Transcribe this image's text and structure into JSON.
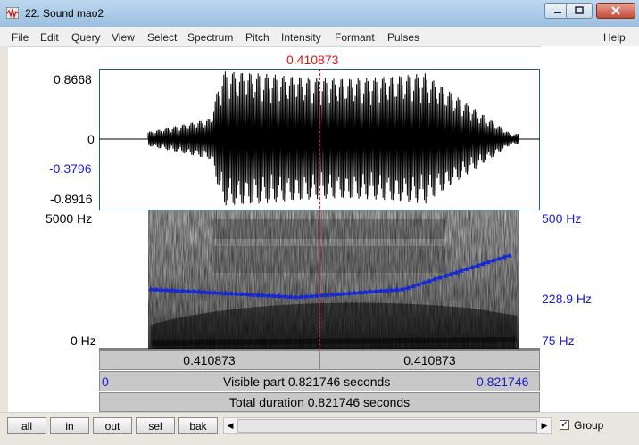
{
  "window": {
    "title": "22. Sound mao2"
  },
  "menu": [
    "File",
    "Edit",
    "Query",
    "View",
    "Select",
    "Spectrum",
    "Pitch",
    "Intensity",
    "Formant",
    "Pulses",
    "Help"
  ],
  "cursor": {
    "time": "0.410873"
  },
  "waveform": {
    "max_label": "0.8668",
    "zero_label": "0",
    "cursor_value": "-0.3796",
    "min_label": "-0.8916"
  },
  "spectrogram": {
    "top_label": "5000 Hz",
    "bottom_label": "0 Hz"
  },
  "pitch": {
    "top_label": "500 Hz",
    "cursor_value": "228.9 Hz",
    "bottom_label": "75 Hz"
  },
  "timebars": {
    "left_segment": "0.410873",
    "right_segment": "0.410873",
    "visible_start": "0",
    "visible_text": "Visible part 0.821746 seconds",
    "visible_end": "0.821746",
    "total_text": "Total duration 0.821746 seconds"
  },
  "buttons": {
    "all": "all",
    "in": "in",
    "out": "out",
    "sel": "sel",
    "bak": "bak"
  },
  "group": {
    "label": "Group",
    "checked": true
  },
  "colors": {
    "pitch_line": "#1428d8",
    "cursor": "#d01a1a",
    "value_blue": "#1b1bd0"
  }
}
